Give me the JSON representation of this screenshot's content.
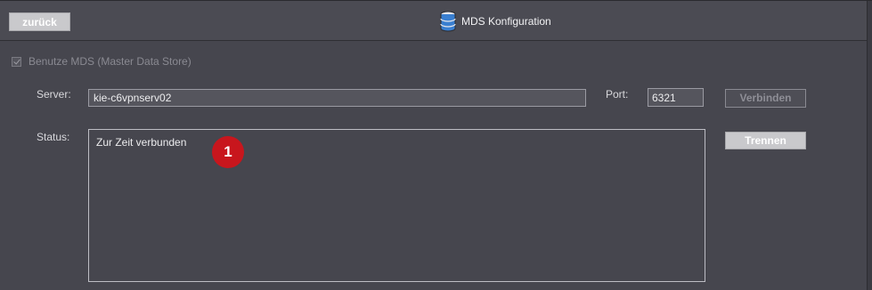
{
  "header": {
    "back_label": "zurück",
    "title": "MDS Konfiguration",
    "title_icon": "database-icon"
  },
  "form": {
    "use_mds_label": "Benutze MDS (Master Data Store)",
    "use_mds_checked": true,
    "server_label": "Server:",
    "server_value": "kie-c6vpnserv02",
    "port_label": "Port:",
    "port_value": "6321",
    "connect_label": "Verbinden",
    "status_label": "Status:",
    "status_text": "Zur Zeit verbunden",
    "disconnect_label": "Trennen"
  },
  "annotation": {
    "badge_number": "1"
  },
  "colors": {
    "background": "#46464e",
    "button_light": "#c9c9cc",
    "badge_red": "#c8161d"
  }
}
